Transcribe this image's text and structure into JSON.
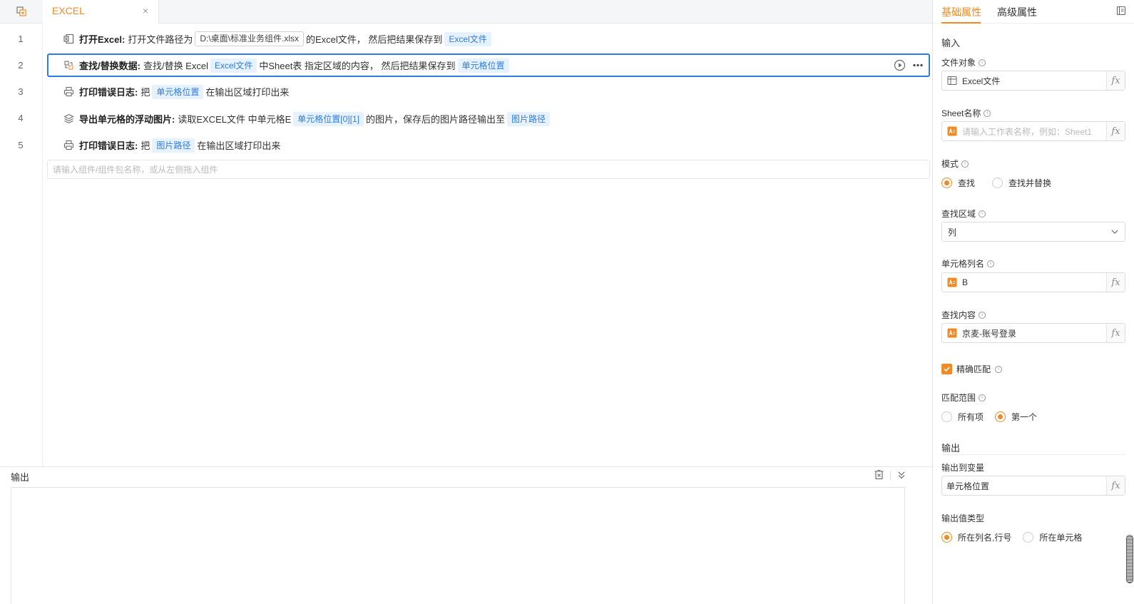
{
  "tab": {
    "label": "EXCEL",
    "close": "×"
  },
  "rows": [
    {
      "no": "1",
      "title": "打开Excel:",
      "t1": "打开文件路径为",
      "path": "D:\\桌面\\标准业务组件.xlsx",
      "t2": "的Excel文件， 然后把结果保存到",
      "chip1": "Excel文件"
    },
    {
      "no": "2",
      "title": "查找/替换数据:",
      "t1": "查找/替换 Excel",
      "chip1": "Excel文件",
      "t2": "中Sheet表 指定区域的内容， 然后把结果保存到",
      "chip2": "单元格位置"
    },
    {
      "no": "3",
      "title": "打印错误日志:",
      "t1": "把",
      "chip1": "单元格位置",
      "t2": "在输出区域打印出来"
    },
    {
      "no": "4",
      "title": "导出单元格的浮动图片:",
      "t1": "读取EXCEL文件 中单元格E",
      "chip1": "单元格位置[0][1]",
      "t2": "的图片，保存后的图片路径输出至",
      "chip2": "图片路径"
    },
    {
      "no": "5",
      "title": "打印错误日志:",
      "t1": "把",
      "chip1": "图片路径",
      "t2": "在输出区域打印出来"
    }
  ],
  "component_search": {
    "placeholder": "请输入组件/组件包名称，或从左侧拖入组件"
  },
  "output": {
    "title": "输出"
  },
  "props": {
    "tabs": [
      "基础属性",
      "高级属性"
    ],
    "input_section": "输入",
    "file_object": {
      "label": "文件对象",
      "value": "Excel文件"
    },
    "sheet_name": {
      "label": "Sheet名称",
      "placeholder": "请输入工作表名称，例如：Sheet1"
    },
    "mode": {
      "label": "模式",
      "options": [
        "查找",
        "查找并替换"
      ],
      "selected": "查找"
    },
    "find_area": {
      "label": "查找区域",
      "value": "列"
    },
    "cell_column": {
      "label": "单元格列名",
      "value": "B"
    },
    "find_content": {
      "label": "查找内容",
      "value": "京麦-账号登录"
    },
    "exact_match": {
      "label": "精确匹配",
      "checked": true
    },
    "match_range": {
      "label": "匹配范围",
      "options": [
        "所有项",
        "第一个"
      ],
      "selected": "第一个"
    },
    "output_section": "输出",
    "output_var": {
      "label": "输出到变量",
      "value": "单元格位置"
    },
    "output_type": {
      "label": "输出值类型",
      "options": [
        "所在列名,行号",
        "所在单元格"
      ],
      "selected": "所在列名,行号"
    },
    "fx": "fx"
  },
  "colors": {
    "accent": "#f08a24",
    "link": "#2f7be5",
    "chip_bg": "#e6f2ff",
    "selected_border": "#2f7be5"
  }
}
